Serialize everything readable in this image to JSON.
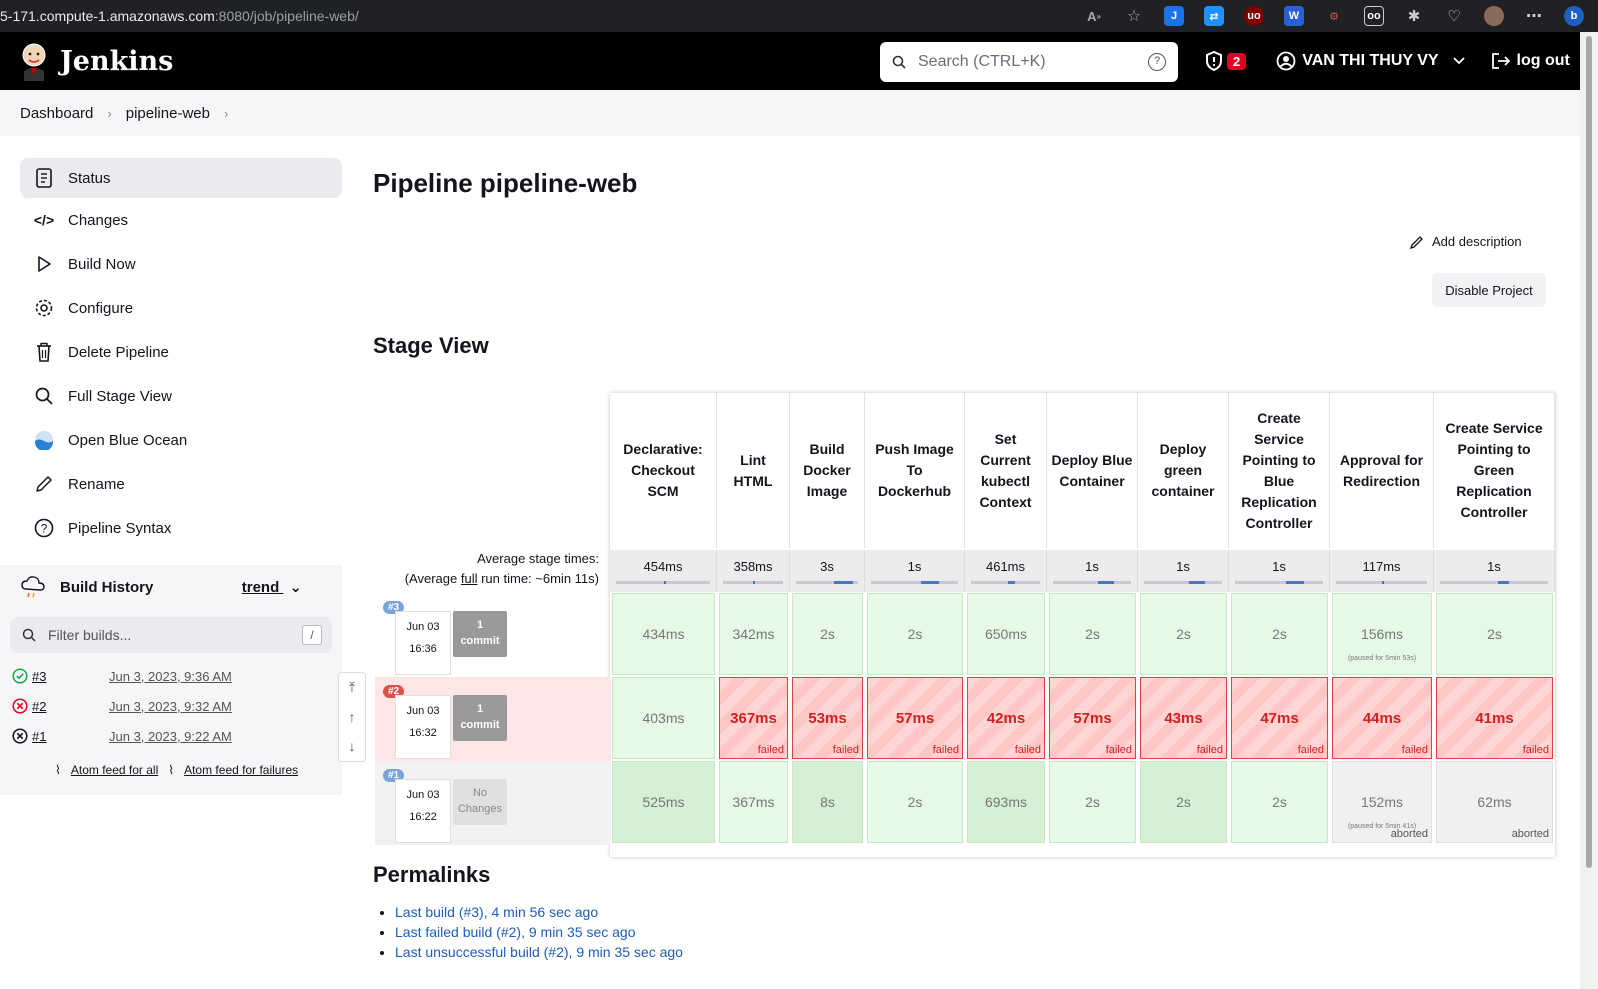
{
  "browser": {
    "url_host": "5-171.compute-1.amazonaws.com",
    "url_path": ":8080/job/pipeline-web/"
  },
  "header": {
    "logo_text": "Jenkins",
    "search_placeholder": "Search (CTRL+K)",
    "security_count": "2",
    "user_name": "VAN THI THUY VY",
    "logout_label": "log out"
  },
  "breadcrumb": [
    "Dashboard",
    "pipeline-web"
  ],
  "sidebar": {
    "items": [
      {
        "label": "Status",
        "icon": "document-icon"
      },
      {
        "label": "Changes",
        "icon": "code-icon"
      },
      {
        "label": "Build Now",
        "icon": "play-icon"
      },
      {
        "label": "Configure",
        "icon": "gear-icon"
      },
      {
        "label": "Delete Pipeline",
        "icon": "trash-icon"
      },
      {
        "label": "Full Stage View",
        "icon": "search-icon"
      },
      {
        "label": "Open Blue Ocean",
        "icon": "blue-ocean-icon"
      },
      {
        "label": "Rename",
        "icon": "pencil-icon"
      },
      {
        "label": "Pipeline Syntax",
        "icon": "help-icon"
      }
    ]
  },
  "build_history": {
    "title": "Build History",
    "trend_label": "trend",
    "filter_placeholder": "Filter builds...",
    "filter_shortcut": "/",
    "builds": [
      {
        "id": "#3",
        "date": "Jun 3, 2023, 9:36 AM",
        "status": "success"
      },
      {
        "id": "#2",
        "date": "Jun 3, 2023, 9:32 AM",
        "status": "failed"
      },
      {
        "id": "#1",
        "date": "Jun 3, 2023, 9:22 AM",
        "status": "aborted"
      }
    ],
    "feed_all": "Atom feed for all",
    "feed_failures": "Atom feed for failures"
  },
  "main": {
    "title": "Pipeline pipeline-web",
    "add_description": "Add description",
    "disable_project": "Disable Project",
    "stage_view_title": "Stage View",
    "avg_label_1": "Average stage times:",
    "avg_label_2a": "(Average ",
    "avg_label_2b": "full",
    "avg_label_2c": " run time: ~6min 11s)",
    "permalinks_title": "Permalinks",
    "permalinks": [
      "Last build (#3), 4 min 56 sec ago",
      "Last failed build (#2), 9 min 35 sec ago",
      "Last unsuccessful build (#2), 9 min 35 sec ago"
    ]
  },
  "stages": [
    {
      "name": "Declarative: Checkout SCM",
      "avg": "454ms",
      "avg_frac": 0.0
    },
    {
      "name": "Lint HTML",
      "avg": "358ms",
      "avg_frac": 0.0
    },
    {
      "name": "Build Docker Image",
      "avg": "3s",
      "avg_frac": 0.3
    },
    {
      "name": "Push Image To Dockerhub",
      "avg": "1s",
      "avg_frac": 0.2
    },
    {
      "name": "Set Current kubectl Context",
      "avg": "461ms",
      "avg_frac": 0.1
    },
    {
      "name": "Deploy Blue Container",
      "avg": "1s",
      "avg_frac": 0.2
    },
    {
      "name": "Deploy green container",
      "avg": "1s",
      "avg_frac": 0.2
    },
    {
      "name": "Create Service Pointing to Blue Replication Controller",
      "avg": "1s",
      "avg_frac": 0.2
    },
    {
      "name": "Approval for Redirection",
      "avg": "117ms",
      "avg_frac": 0.0
    },
    {
      "name": "Create Service Pointing to Green Replication Controller",
      "avg": "1s",
      "avg_frac": 0.1
    }
  ],
  "runs": [
    {
      "badge": "#3",
      "date": "Jun 03",
      "time": "16:36",
      "commit_1": "1",
      "commit_2": "commit",
      "cells": [
        {
          "v": "434ms",
          "s": "ok"
        },
        {
          "v": "342ms",
          "s": "ok"
        },
        {
          "v": "2s",
          "s": "ok"
        },
        {
          "v": "2s",
          "s": "ok"
        },
        {
          "v": "650ms",
          "s": "ok"
        },
        {
          "v": "2s",
          "s": "ok"
        },
        {
          "v": "2s",
          "s": "ok"
        },
        {
          "v": "2s",
          "s": "ok"
        },
        {
          "v": "156ms",
          "s": "ok",
          "note": "(paused for 5min 53s)"
        },
        {
          "v": "2s",
          "s": "ok"
        }
      ]
    },
    {
      "badge": "#2",
      "date": "Jun 03",
      "time": "16:32",
      "commit_1": "1",
      "commit_2": "commit",
      "cells": [
        {
          "v": "403ms",
          "s": "ok"
        },
        {
          "v": "367ms",
          "s": "fail"
        },
        {
          "v": "53ms",
          "s": "fail"
        },
        {
          "v": "57ms",
          "s": "fail"
        },
        {
          "v": "42ms",
          "s": "fail"
        },
        {
          "v": "57ms",
          "s": "fail"
        },
        {
          "v": "43ms",
          "s": "fail"
        },
        {
          "v": "47ms",
          "s": "fail"
        },
        {
          "v": "44ms",
          "s": "fail"
        },
        {
          "v": "41ms",
          "s": "fail"
        }
      ]
    },
    {
      "badge": "#1",
      "date": "Jun 03",
      "time": "16:22",
      "commit_1": "No",
      "commit_2": "Changes",
      "cells": [
        {
          "v": "525ms",
          "s": "ok2"
        },
        {
          "v": "367ms",
          "s": "ok"
        },
        {
          "v": "8s",
          "s": "ok2"
        },
        {
          "v": "2s",
          "s": "ok"
        },
        {
          "v": "693ms",
          "s": "ok2"
        },
        {
          "v": "2s",
          "s": "ok"
        },
        {
          "v": "2s",
          "s": "ok2"
        },
        {
          "v": "2s",
          "s": "ok"
        },
        {
          "v": "152ms",
          "s": "grey",
          "note": "(paused for 5min 41s)",
          "tag": "aborted"
        },
        {
          "v": "62ms",
          "s": "grey",
          "tag": "aborted"
        }
      ]
    }
  ],
  "labels": {
    "failed": "failed"
  },
  "colors": {
    "success": "#1ea64b",
    "failure": "#e6001f",
    "accent": "#1d5dbd"
  }
}
